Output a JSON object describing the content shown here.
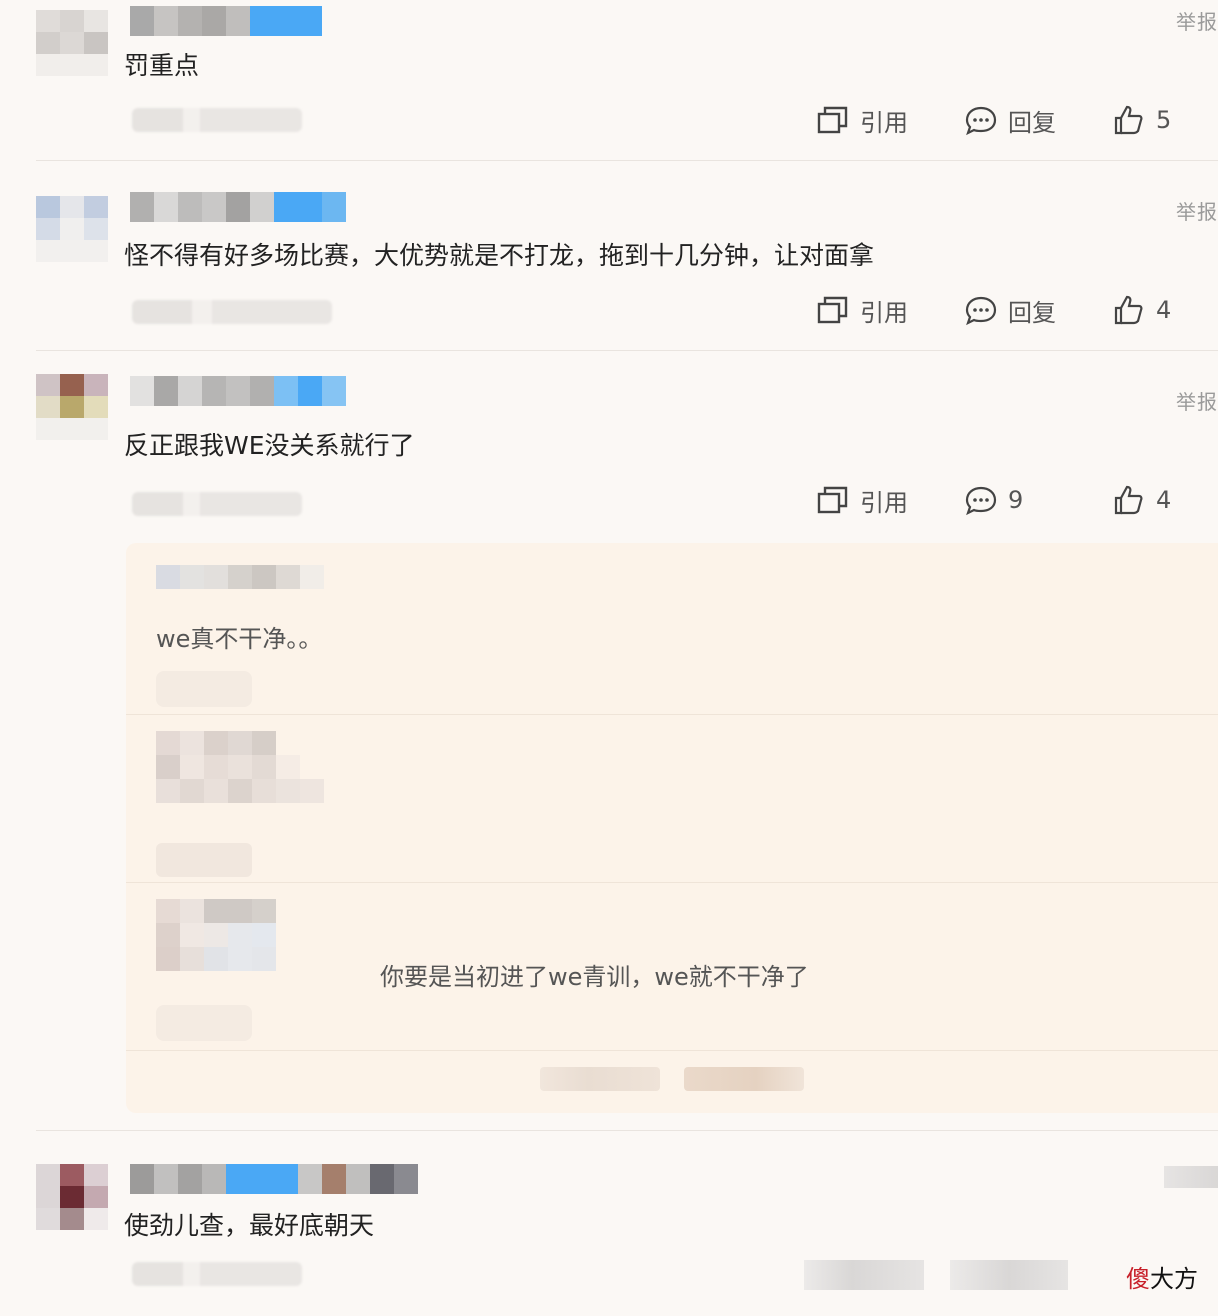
{
  "report_label": "举报",
  "actions": {
    "quote_label": "引用",
    "reply_label": "回复"
  },
  "comments": [
    {
      "text": "罚重点",
      "reply_action": "回复",
      "likes": "5"
    },
    {
      "text": "怪不得有好多场比赛，大优势就是不打龙，拖到十几分钟，让对面拿",
      "reply_action": "回复",
      "likes": "4"
    },
    {
      "text": "反正跟我WE没关系就行了",
      "reply_count": "9",
      "likes": "4"
    },
    {
      "text": "使劲儿查，最好底朝天"
    }
  ],
  "replies": [
    {
      "text": "we真不干净。。"
    },
    {
      "text": "你要是当初进了we青训，we就不干净了"
    }
  ],
  "watermark": {
    "first": "傻",
    "rest": "大方"
  },
  "colors": {
    "background": "#fbf8f5",
    "reply_box": "#fcf3e9",
    "name_highlight": "#4aa8f5",
    "watermark_red": "#c8202a"
  },
  "icons": [
    "quote-icon",
    "comment-icon",
    "thumbs-up-icon"
  ]
}
